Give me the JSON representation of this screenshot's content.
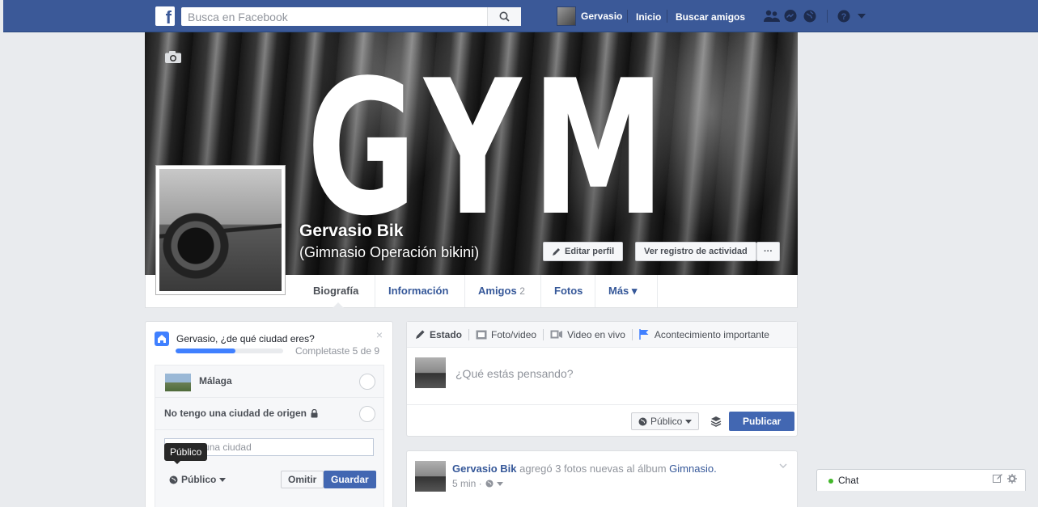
{
  "header": {
    "search_placeholder": "Busca en Facebook",
    "user_name": "Gervasio",
    "home_link": "Inicio",
    "find_friends_link": "Buscar amigos"
  },
  "cover": {
    "banner_text": "GYM",
    "name": "Gervasio Bik",
    "subtitle": "(Gimnasio Operación bikini)",
    "edit_profile_button": "Editar perfil",
    "activity_log_button": "Ver registro de actividad",
    "more_button": "···"
  },
  "tabs": [
    {
      "label": "Biografía"
    },
    {
      "label": "Información"
    },
    {
      "label": "Amigos",
      "count": "2"
    },
    {
      "label": "Fotos"
    },
    {
      "label": "Más ▾"
    }
  ],
  "city_prompt": {
    "question": "Gervasio, ¿de qué ciudad eres?",
    "progress_text": "Completaste 5 de 9",
    "progress_fraction": 0.556,
    "option_city": "Málaga",
    "option_no_hometown": "No tengo una ciudad de origen",
    "city_input_placeholder": "Agrega una ciudad",
    "tooltip": "Público",
    "privacy_label": "Público",
    "skip_button": "Omitir",
    "save_button": "Guardar",
    "close_glyph": "×"
  },
  "composer": {
    "tab_status": "Estado",
    "tab_photo": "Foto/video",
    "tab_live": "Video en vivo",
    "tab_event": "Acontecimiento importante",
    "placeholder": "¿Qué estás pensando?",
    "privacy_label": "Público",
    "publish_button": "Publicar"
  },
  "post": {
    "author": "Gervasio Bik",
    "action": "agregó 3 fotos nuevas al álbum",
    "album": "Gimnasio.",
    "time": "5 min ·"
  },
  "chat": {
    "label": "Chat"
  },
  "colors": {
    "brand_blue": "#3b5998",
    "button_blue": "#4267b2",
    "progress_blue": "#4080ff",
    "online_green": "#42b72a"
  }
}
